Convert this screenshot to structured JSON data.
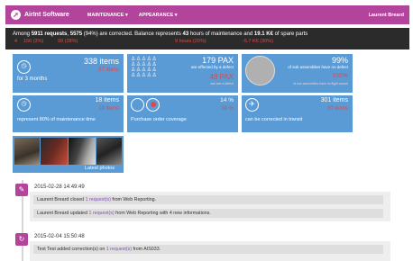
{
  "nav": {
    "brand": "AirInt Software",
    "menu": [
      "MAINTENANCE",
      "APPEARANCE"
    ],
    "user": "Laurent Breard"
  },
  "summary": {
    "text_a": "Among ",
    "requests_count": "5911 requests",
    "text_b": ", ",
    "corrected_count": "5575",
    "text_c": " (94%) are corrected. Balance represents ",
    "hours": "43",
    "text_d": " hours of maintenance and ",
    "spares": "19.1 K€",
    "text_e": " of spare parts",
    "deltas": [
      "4",
      "156 (3%)",
      "99 (28%)",
      "9 hours (20%)",
      "-5.7 K€ (30%)"
    ]
  },
  "tiles": {
    "t1": {
      "big": "338 items",
      "red": "87 items",
      "label": "for 3 months",
      "icon": "clock-icon"
    },
    "t2": {
      "big": "179 PAX",
      "sub": "are effected by a defect",
      "red": "48 PAX",
      "small": "can see a defect",
      "icon": "people-icon"
    },
    "t3": {
      "big": "99%",
      "sub": "of sub assemblies have no defect",
      "red": "100%",
      "small": "of sub assemblies have no flight cancel",
      "icon": "pie-icon"
    },
    "t4": {
      "big": "18 items",
      "red": "18 items",
      "label": "represent 80% of maintenance time",
      "icon": "clock-icon"
    },
    "t5": {
      "big": "14 %",
      "red": "38 %",
      "label": "Purchase order coverage",
      "icon": "donut-icon"
    },
    "t6": {
      "big": "301 items",
      "red": "87 items",
      "label": "can be corrected in transit",
      "icon": "plane-icon"
    },
    "photos": {
      "label": "Latest photos"
    }
  },
  "timeline": [
    {
      "date": "2015-02-28 14:49:49",
      "icon": "edit-icon",
      "entries": [
        {
          "pre": "Laurent Breard closed ",
          "link": "1 request(s)",
          "post": " from Web Reporting."
        },
        {
          "pre": "Laurent Breard updated ",
          "link": "1 request(s)",
          "post": " from Web Reporting with 4 new informations."
        }
      ]
    },
    {
      "date": "2015-02-04 15:50:48",
      "icon": "refresh-icon",
      "entries": [
        {
          "pre": "Test Test added correction(s) on ",
          "link": "1 request(s)",
          "post": " from AIS033."
        }
      ]
    }
  ]
}
